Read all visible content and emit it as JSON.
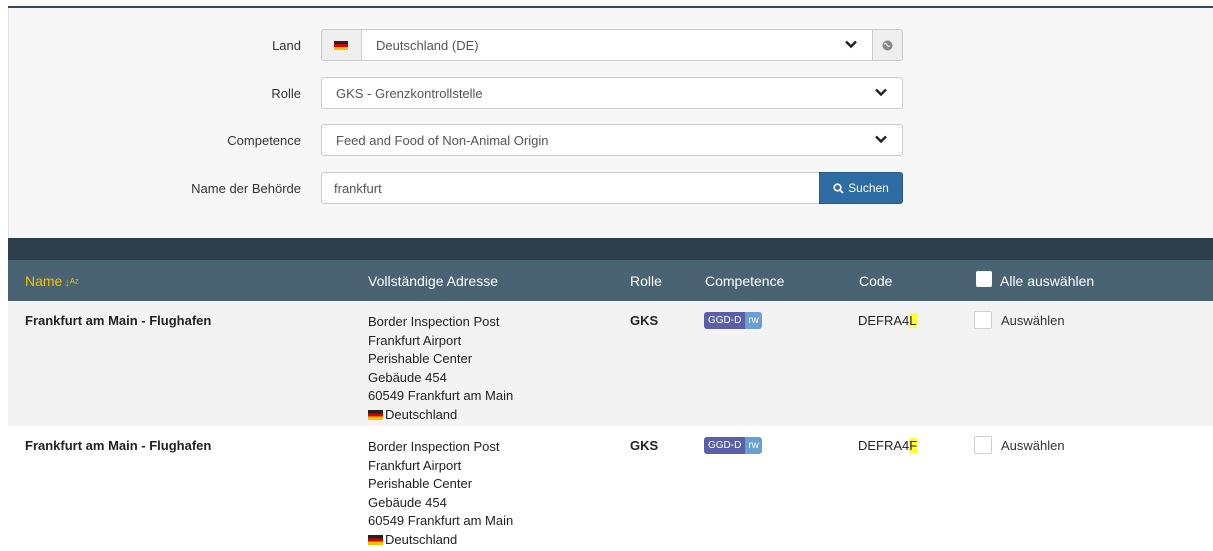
{
  "form": {
    "land": {
      "label": "Land",
      "value": "Deutschland (DE)",
      "flag_colors": [
        "#222222",
        "#dd0000",
        "#f5c400"
      ]
    },
    "rolle": {
      "label": "Rolle",
      "value": "GKS - Grenzkontrollstelle"
    },
    "competence": {
      "label": "Competence",
      "value": "Feed and Food of Non-Animal Origin"
    },
    "name": {
      "label": "Name der Behörde",
      "value": "frankfurt"
    },
    "search_label": "Suchen"
  },
  "table": {
    "headers": {
      "name": "Name",
      "address": "Vollständige Adresse",
      "rolle": "Rolle",
      "competence": "Competence",
      "code": "Code",
      "select_all": "Alle auswählen"
    },
    "rows": [
      {
        "name": "Frankfurt am Main - Flughafen",
        "address": [
          "Border Inspection Post",
          "Frankfurt Airport",
          "Perishable Center",
          "Gebäude 454",
          "60549 Frankfurt am Main"
        ],
        "country": "Deutschland",
        "rolle": "GKS",
        "badge_main": "GGD-D",
        "badge_sub": "rw",
        "code_prefix": "DEFRA4",
        "code_suffix": "L",
        "select_label": "Auswählen"
      },
      {
        "name": "Frankfurt am Main - Flughafen",
        "address": [
          "Border Inspection Post",
          "Frankfurt Airport",
          "Perishable Center",
          "Gebäude 454",
          "60549 Frankfurt am Main"
        ],
        "country": "Deutschland",
        "rolle": "GKS",
        "badge_main": "GGD-D",
        "badge_sub": "rw",
        "code_prefix": "DEFRA4",
        "code_suffix": "F",
        "select_label": "Auswählen"
      }
    ]
  },
  "colors": {
    "header_bg": "#4a6373",
    "dark_bar": "#2c3e4c",
    "sort_accent": "#f2c100",
    "button_blue": "#2e6da4",
    "highlight": "#ffff33"
  },
  "icons": {
    "sort": "sort-alpha-asc-icon",
    "search": "search-icon",
    "globe": "globe-icon",
    "chevron": "chevron-down-icon"
  }
}
